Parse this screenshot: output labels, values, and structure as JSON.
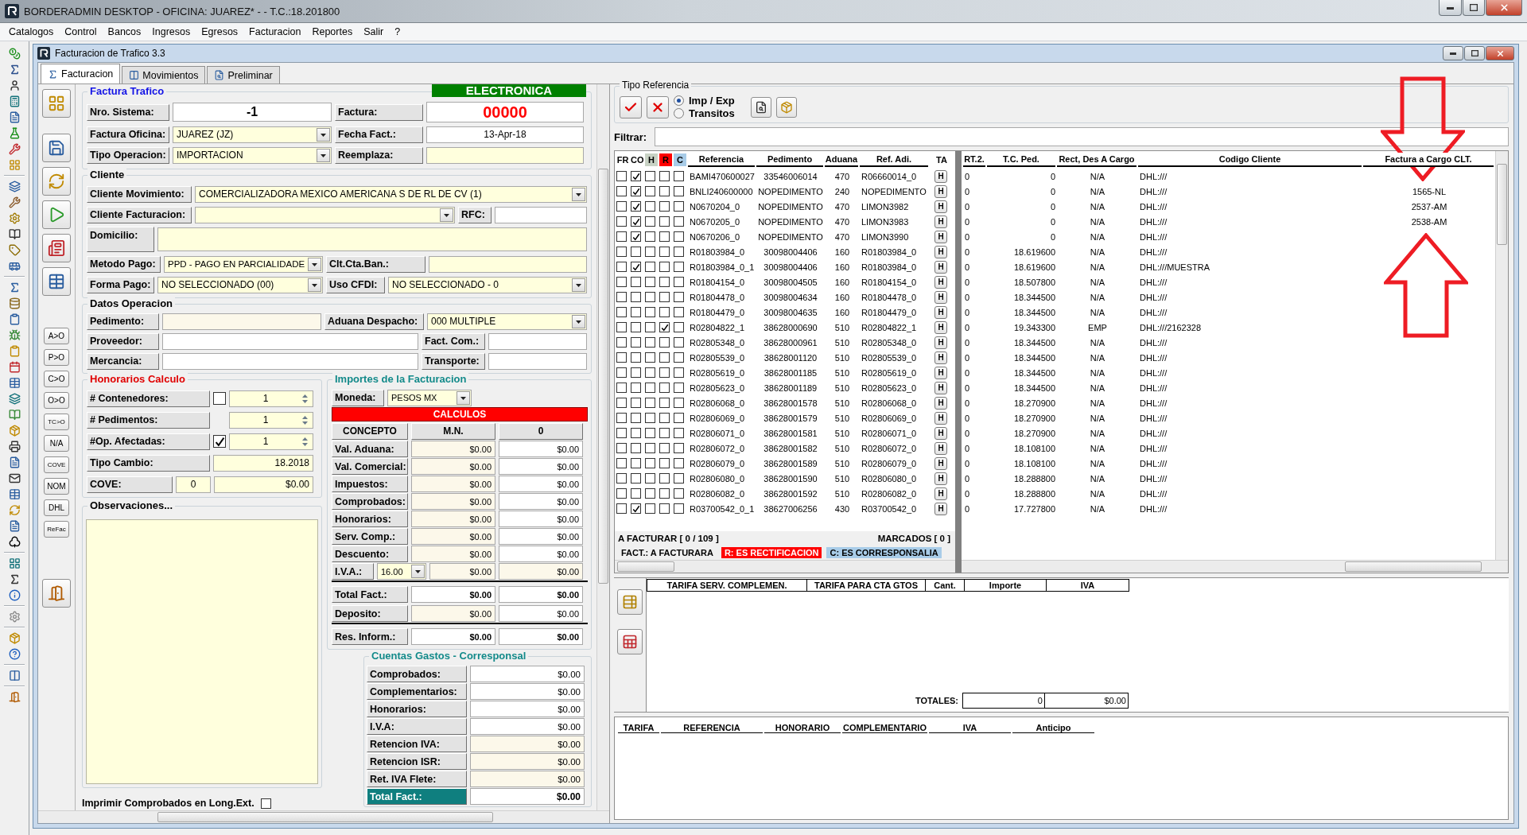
{
  "app": {
    "title": "BORDERADMIN DESKTOP - OFICINA: JUAREZ* -  - T.C.:18.201800"
  },
  "menu": [
    "Catalogos",
    "Control",
    "Bancos",
    "Ingresos",
    "Egresos",
    "Facturacion",
    "Reportes",
    "Salir",
    "?"
  ],
  "window": {
    "title": "Facturacion de Trafico 3.3"
  },
  "tabs": [
    {
      "label": "Facturacion",
      "selected": true
    },
    {
      "label": "Movimientos",
      "selected": false
    },
    {
      "label": "Preliminar",
      "selected": false
    }
  ],
  "side_buttons": [
    "A>O",
    "P>O",
    "C>O",
    "O>O",
    "TC>O",
    "N/A",
    "COVE",
    "NOM",
    "DHL",
    "ReFac"
  ],
  "factura_trafico": {
    "title": "Factura Trafico",
    "badge": "ELECTRONICA",
    "nro_sistema": {
      "label": "Nro. Sistema:",
      "value": "-1"
    },
    "factura": {
      "label": "Factura:",
      "value": "00000"
    },
    "factura_oficina": {
      "label": "Factura Oficina:",
      "value": "JUAREZ (JZ)"
    },
    "fecha_fact": {
      "label": "Fecha Fact.:",
      "value": "13-Apr-18"
    },
    "tipo_operacion": {
      "label": "Tipo Operacion:",
      "value": "IMPORTACION"
    },
    "reemplaza": {
      "label": "Reemplaza:"
    }
  },
  "cliente": {
    "title": "Cliente",
    "cliente_movimiento": {
      "label": "Cliente Movimiento:",
      "value": "COMERCIALIZADORA MEXICO AMERICANA S DE RL DE CV (1)"
    },
    "cliente_facturacion": {
      "label": "Cliente Facturacion:"
    },
    "rfc": {
      "label": "RFC:"
    },
    "domicilio": {
      "label": "Domicilio:"
    },
    "metodo_pago": {
      "label": "Metodo Pago:",
      "value": "PPD - PAGO EN PARCIALIDADE"
    },
    "clt_cta_ban": {
      "label": "Clt.Cta.Ban.:"
    },
    "forma_pago": {
      "label": "Forma Pago:",
      "value": "NO SELECCIONADO (00)"
    },
    "uso_cfdi": {
      "label": "Uso CFDI:",
      "value": "NO SELECCIONADO - 0"
    }
  },
  "datos_operacion": {
    "title": "Datos Operacion",
    "pedimento": {
      "label": "Pedimento:"
    },
    "aduana_despacho": {
      "label": "Aduana Despacho:",
      "value": "000 MULTIPLE"
    },
    "proveedor": {
      "label": "Proveedor:"
    },
    "fact_com": {
      "label": "Fact. Com.:"
    },
    "mercancia": {
      "label": "Mercancia:"
    },
    "transporte": {
      "label": "Transporte:"
    }
  },
  "honorarios": {
    "title": "Honorarios Calculo",
    "rows": [
      {
        "label": "# Contenedores:",
        "kind": "spinner",
        "checked": false,
        "value": "1"
      },
      {
        "label": "# Pedimentos:",
        "kind": "spinner",
        "value": "1"
      },
      {
        "label": "#Op. Afectadas:",
        "kind": "spinner",
        "checked": true,
        "value": "1"
      },
      {
        "label": "Tipo Cambio:",
        "kind": "field",
        "value": "18.2018"
      },
      {
        "label": "COVE:",
        "kind": "cove",
        "count": "0",
        "value": "$0.00"
      }
    ]
  },
  "observaciones": {
    "title": "Observaciones...",
    "imprimir": {
      "label": "Imprimir Comprobados en Long.Ext.",
      "checked": false
    }
  },
  "importes": {
    "title": "Importes de la Facturacion",
    "moneda": {
      "label": "Moneda:",
      "value": "PESOS MX"
    },
    "banner": "CALCULOS",
    "columns": [
      "CONCEPTO",
      "M.N.",
      "0"
    ],
    "rows": [
      {
        "label": "Val. Aduana:",
        "kind": "amount",
        "mn": "$0.00",
        "other": "$0.00"
      },
      {
        "label": "Val. Comercial:",
        "kind": "amount",
        "mn": "$0.00",
        "other": "$0.00"
      },
      {
        "label": "Impuestos:",
        "kind": "amount",
        "mn": "$0.00",
        "other": "$0.00"
      },
      {
        "label": "Comprobados:",
        "kind": "amount",
        "mn": "$0.00",
        "other": "$0.00"
      },
      {
        "label": "Honorarios:",
        "kind": "amount",
        "mn": "$0.00",
        "other": "$0.00"
      },
      {
        "label": "Serv. Comp.:",
        "kind": "amount",
        "mn": "$0.00",
        "other": "$0.00"
      },
      {
        "label": "Descuento:",
        "kind": "amount",
        "mn": "$0.00",
        "other": "$0.00"
      },
      {
        "label": "I.V.A.:",
        "kind": "iva",
        "rate": "16.00",
        "mn": "$0.00",
        "other": "$0.00"
      },
      {
        "label": "Total Fact.:",
        "kind": "total",
        "mn": "$0.00",
        "other": "$0.00"
      },
      {
        "label": "Deposito:",
        "kind": "amount",
        "mn": "$0.00",
        "other": "$0.00"
      },
      {
        "label": "Res. Inform.:",
        "kind": "total",
        "mn": "$0.00",
        "other": "$0.00"
      }
    ]
  },
  "cuentas_gastos": {
    "title": "Cuentas Gastos - Corresponsal",
    "rows": [
      {
        "label": "Comprobados:",
        "kind": "amount",
        "value": "$0.00"
      },
      {
        "label": "Complementarios:",
        "kind": "amount",
        "value": "$0.00"
      },
      {
        "label": "Honorarios:",
        "kind": "amount",
        "value": "$0.00"
      },
      {
        "label": "I.V.A:",
        "kind": "amount",
        "value": "$0.00"
      },
      {
        "label": "Retencion IVA:",
        "kind": "amount",
        "value": "$0.00"
      },
      {
        "label": "Retencion ISR:",
        "kind": "amount",
        "value": "$0.00"
      },
      {
        "label": "Ret. IVA Flete:",
        "kind": "amount",
        "value": "$0.00"
      },
      {
        "label": "Total Fact.:",
        "kind": "total",
        "value": "$0.00"
      }
    ]
  },
  "tipo_referencia": {
    "title": "Tipo Referencia",
    "options": [
      {
        "label": "Imp / Exp",
        "selected": true
      },
      {
        "label": "Transitos",
        "selected": false
      }
    ]
  },
  "filtrar": {
    "label": "Filtrar:"
  },
  "grid": {
    "flag_columns": [
      {
        "label": "FR",
        "color": "#ffffff"
      },
      {
        "label": "CO",
        "color": "#ffffff"
      },
      {
        "label": "H",
        "color": "#c8d2c4"
      },
      {
        "label": "R",
        "color": "#ff0000"
      },
      {
        "label": "C",
        "color": "#a8cce8"
      }
    ],
    "columns": [
      "Referencia",
      "Pedimento",
      "Aduana",
      "Ref. Adi.",
      "TA",
      "RT.2.",
      "T.C. Ped.",
      "Rect, Des A Cargo",
      "Codigo Cliente",
      "Factura a Cargo CLT."
    ],
    "rows": [
      {
        "flags": [
          false,
          true,
          false,
          false,
          false
        ],
        "referencia": "BAMI470600027",
        "pedimento": "33546006014",
        "aduana": "470",
        "ref_adi": "R06660014_0",
        "ta": "H",
        "rt2": "0",
        "tc_ped": "0",
        "rect": "N/A",
        "codigo": "DHL:///"
      },
      {
        "flags": [
          false,
          true,
          false,
          false,
          false
        ],
        "referencia": "BNLI240600000",
        "pedimento": "NOPEDIMENTO",
        "aduana": "240",
        "ref_adi": "NOPEDIMENTO",
        "ta": "H",
        "rt2": "0",
        "tc_ped": "0",
        "rect": "N/A",
        "codigo": "DHL:///",
        "factura_cargo": "1565-NL"
      },
      {
        "flags": [
          false,
          true,
          false,
          false,
          false
        ],
        "referencia": "N0670204_0",
        "pedimento": "NOPEDIMENTO",
        "aduana": "470",
        "ref_adi": "LIMON3982",
        "ta": "H",
        "rt2": "0",
        "tc_ped": "0",
        "rect": "N/A",
        "codigo": "DHL:///",
        "factura_cargo": "2537-AM"
      },
      {
        "flags": [
          false,
          true,
          false,
          false,
          false
        ],
        "referencia": "N0670205_0",
        "pedimento": "NOPEDIMENTO",
        "aduana": "470",
        "ref_adi": "LIMON3983",
        "ta": "H",
        "rt2": "0",
        "tc_ped": "0",
        "rect": "N/A",
        "codigo": "DHL:///",
        "factura_cargo": "2538-AM"
      },
      {
        "flags": [
          false,
          true,
          false,
          false,
          false
        ],
        "referencia": "N0670206_0",
        "pedimento": "NOPEDIMENTO",
        "aduana": "470",
        "ref_adi": "LIMON3990",
        "ta": "H",
        "rt2": "0",
        "tc_ped": "0",
        "rect": "N/A",
        "codigo": "DHL:///"
      },
      {
        "flags": [
          false,
          false,
          false,
          false,
          false
        ],
        "referencia": "R01803984_0",
        "pedimento": "30098004406",
        "aduana": "160",
        "ref_adi": "R01803984_0",
        "ta": "H",
        "rt2": "0",
        "tc_ped": "18.619600",
        "rect": "N/A",
        "codigo": "DHL:///"
      },
      {
        "flags": [
          false,
          true,
          false,
          false,
          false
        ],
        "referencia": "R01803984_0_1",
        "pedimento": "30098004406",
        "aduana": "160",
        "ref_adi": "R01803984_0",
        "ta": "H",
        "rt2": "0",
        "tc_ped": "18.619600",
        "rect": "N/A",
        "codigo": "DHL:///MUESTRA"
      },
      {
        "flags": [
          false,
          false,
          false,
          false,
          false
        ],
        "referencia": "R01804154_0",
        "pedimento": "30098004505",
        "aduana": "160",
        "ref_adi": "R01804154_0",
        "ta": "H",
        "rt2": "0",
        "tc_ped": "18.507800",
        "rect": "N/A",
        "codigo": "DHL:///"
      },
      {
        "flags": [
          false,
          false,
          false,
          false,
          false
        ],
        "referencia": "R01804478_0",
        "pedimento": "30098004634",
        "aduana": "160",
        "ref_adi": "R01804478_0",
        "ta": "H",
        "rt2": "0",
        "tc_ped": "18.344500",
        "rect": "N/A",
        "codigo": "DHL:///"
      },
      {
        "flags": [
          false,
          false,
          false,
          false,
          false
        ],
        "referencia": "R01804479_0",
        "pedimento": "30098004635",
        "aduana": "160",
        "ref_adi": "R01804479_0",
        "ta": "H",
        "rt2": "0",
        "tc_ped": "18.344500",
        "rect": "N/A",
        "codigo": "DHL:///"
      },
      {
        "flags": [
          false,
          false,
          false,
          true,
          false
        ],
        "referencia": "R02804822_1",
        "pedimento": "38628000690",
        "aduana": "510",
        "ref_adi": "R02804822_1",
        "ta": "H",
        "rt2": "0",
        "tc_ped": "19.343300",
        "rect": "EMP",
        "codigo": "DHL:///2162328"
      },
      {
        "flags": [
          false,
          false,
          false,
          false,
          false
        ],
        "referencia": "R02805348_0",
        "pedimento": "38628000961",
        "aduana": "510",
        "ref_adi": "R02805348_0",
        "ta": "H",
        "rt2": "0",
        "tc_ped": "18.344500",
        "rect": "N/A",
        "codigo": "DHL:///"
      },
      {
        "flags": [
          false,
          false,
          false,
          false,
          false
        ],
        "referencia": "R02805539_0",
        "pedimento": "38628001120",
        "aduana": "510",
        "ref_adi": "R02805539_0",
        "ta": "H",
        "rt2": "0",
        "tc_ped": "18.344500",
        "rect": "N/A",
        "codigo": "DHL:///"
      },
      {
        "flags": [
          false,
          false,
          false,
          false,
          false
        ],
        "referencia": "R02805619_0",
        "pedimento": "38628001185",
        "aduana": "510",
        "ref_adi": "R02805619_0",
        "ta": "H",
        "rt2": "0",
        "tc_ped": "18.344500",
        "rect": "N/A",
        "codigo": "DHL:///"
      },
      {
        "flags": [
          false,
          false,
          false,
          false,
          false
        ],
        "referencia": "R02805623_0",
        "pedimento": "38628001189",
        "aduana": "510",
        "ref_adi": "R02805623_0",
        "ta": "H",
        "rt2": "0",
        "tc_ped": "18.344500",
        "rect": "N/A",
        "codigo": "DHL:///"
      },
      {
        "flags": [
          false,
          false,
          false,
          false,
          false
        ],
        "referencia": "R02806068_0",
        "pedimento": "38628001578",
        "aduana": "510",
        "ref_adi": "R02806068_0",
        "ta": "H",
        "rt2": "0",
        "tc_ped": "18.270900",
        "rect": "N/A",
        "codigo": "DHL:///"
      },
      {
        "flags": [
          false,
          false,
          false,
          false,
          false
        ],
        "referencia": "R02806069_0",
        "pedimento": "38628001579",
        "aduana": "510",
        "ref_adi": "R02806069_0",
        "ta": "H",
        "rt2": "0",
        "tc_ped": "18.270900",
        "rect": "N/A",
        "codigo": "DHL:///"
      },
      {
        "flags": [
          false,
          false,
          false,
          false,
          false
        ],
        "referencia": "R02806071_0",
        "pedimento": "38628001581",
        "aduana": "510",
        "ref_adi": "R02806071_0",
        "ta": "H",
        "rt2": "0",
        "tc_ped": "18.270900",
        "rect": "N/A",
        "codigo": "DHL:///"
      },
      {
        "flags": [
          false,
          false,
          false,
          false,
          false
        ],
        "referencia": "R02806072_0",
        "pedimento": "38628001582",
        "aduana": "510",
        "ref_adi": "R02806072_0",
        "ta": "H",
        "rt2": "0",
        "tc_ped": "18.108100",
        "rect": "N/A",
        "codigo": "DHL:///"
      },
      {
        "flags": [
          false,
          false,
          false,
          false,
          false
        ],
        "referencia": "R02806079_0",
        "pedimento": "38628001589",
        "aduana": "510",
        "ref_adi": "R02806079_0",
        "ta": "H",
        "rt2": "0",
        "tc_ped": "18.108100",
        "rect": "N/A",
        "codigo": "DHL:///"
      },
      {
        "flags": [
          false,
          false,
          false,
          false,
          false
        ],
        "referencia": "R02806080_0",
        "pedimento": "38628001590",
        "aduana": "510",
        "ref_adi": "R02806080_0",
        "ta": "H",
        "rt2": "0",
        "tc_ped": "18.288800",
        "rect": "N/A",
        "codigo": "DHL:///"
      },
      {
        "flags": [
          false,
          false,
          false,
          false,
          false
        ],
        "referencia": "R02806082_0",
        "pedimento": "38628001592",
        "aduana": "510",
        "ref_adi": "R02806082_0",
        "ta": "H",
        "rt2": "0",
        "tc_ped": "18.288800",
        "rect": "N/A",
        "codigo": "DHL:///"
      },
      {
        "flags": [
          false,
          true,
          false,
          false,
          false
        ],
        "referencia": "R03700542_0_1",
        "pedimento": "38627006256",
        "aduana": "430",
        "ref_adi": "R03700542_0",
        "ta": "H",
        "rt2": "0",
        "tc_ped": "17.727800",
        "rect": "N/A",
        "codigo": "DHL:///"
      }
    ],
    "a_facturar": "A FACTURAR [ 0 / 109 ]",
    "marcados": "MARCADOS [ 0 ]",
    "legend": [
      {
        "label": "FACT.: A FACTURARA",
        "color": "#f0f0f0"
      },
      {
        "label": "R: ES RECTIFICACION",
        "color": "#ff0000"
      },
      {
        "label": "C: ES CORRESPONSALIA",
        "color": "#a8cce8"
      }
    ]
  },
  "servicios": {
    "columns": [
      "TARIFA SERV. COMPLEMEN.",
      "TARIFA PARA CTA GTOS",
      "Cant.",
      "Importe",
      "IVA"
    ],
    "totales": {
      "label": "TOTALES:",
      "values": [
        "0",
        "$0.00"
      ]
    }
  },
  "anticipos": {
    "columns": [
      "TARIFA",
      "REFERENCIA",
      "HONORARIO",
      "COMPLEMENTARIO",
      "IVA",
      "Anticipo"
    ]
  }
}
